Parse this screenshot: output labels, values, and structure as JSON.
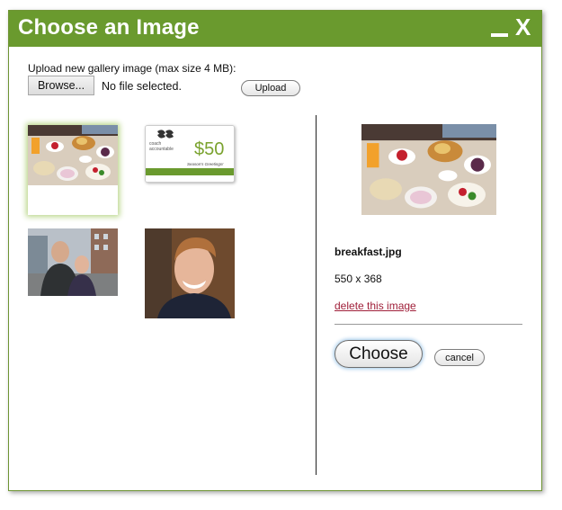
{
  "dialog": {
    "title": "Choose an Image",
    "minimize_icon": "minimize-icon",
    "close_label": "X",
    "title_bar_color": "#6a9a2e"
  },
  "upload": {
    "label": "Upload new gallery image (max size 4 MB):",
    "browse_label": "Browse...",
    "file_status": "No file selected.",
    "upload_label": "Upload"
  },
  "gallery": {
    "images": [
      {
        "name": "breakfast-photo",
        "selected": true
      },
      {
        "name": "gift-card-image",
        "selected": false,
        "brand_line1": "coach",
        "brand_line2": "accountable",
        "amount": "$50",
        "caption": "Season's Greetings!"
      },
      {
        "name": "two-men-city-photo",
        "selected": false
      },
      {
        "name": "man-portrait-photo",
        "selected": false
      }
    ]
  },
  "details": {
    "filename": "breakfast.jpg",
    "dimensions": "550 x 368",
    "delete_label": "delete this image",
    "choose_label": "Choose",
    "cancel_label": "cancel"
  }
}
